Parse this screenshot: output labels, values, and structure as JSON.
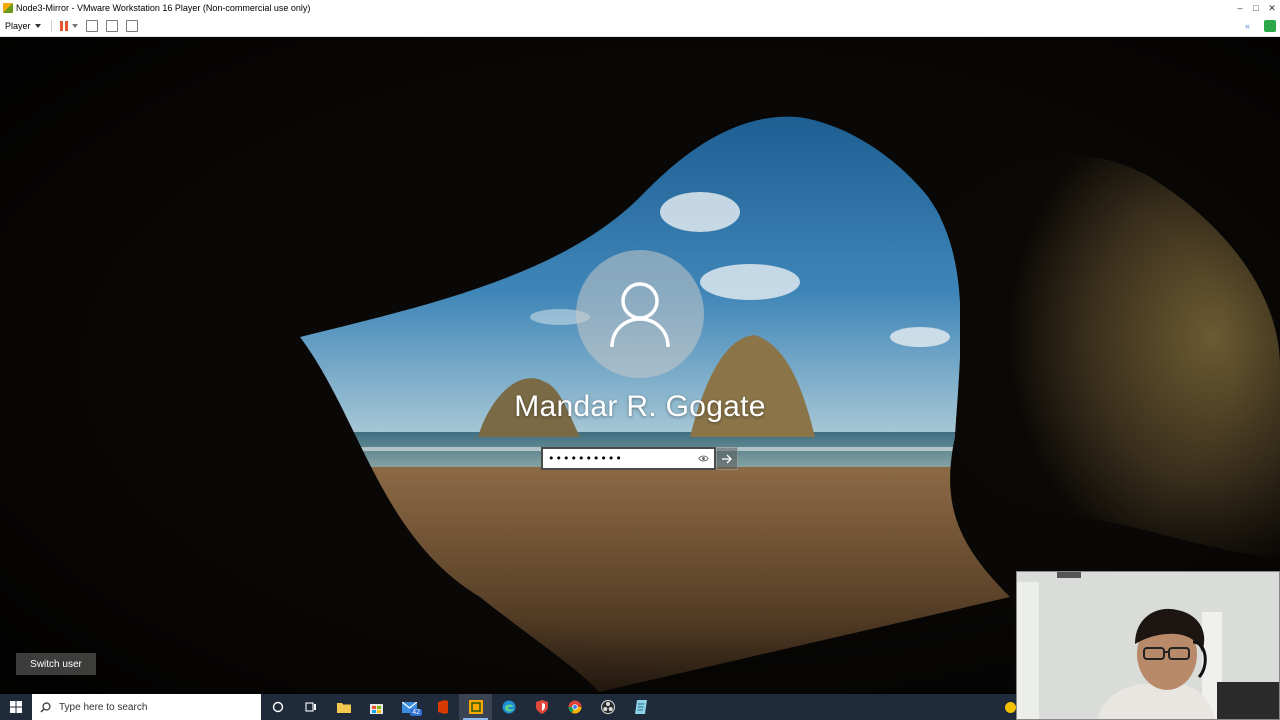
{
  "window": {
    "title": "Node3-Mirror - VMware Workstation 16 Player (Non-commercial use only)"
  },
  "toolbar": {
    "player_label": "Player"
  },
  "lock_screen": {
    "user_name": "Mandar R. Gogate",
    "password_value": "••••••••••",
    "switch_user_label": "Switch user"
  },
  "taskbar": {
    "search_placeholder": "Type here to search",
    "mail_badge": "42",
    "apps": [
      "task-view-icon",
      "file-explorer-icon",
      "store-icon",
      "mail-icon",
      "office-icon",
      "vmware-icon",
      "edge-icon",
      "shield-icon",
      "chrome-icon",
      "obs-icon",
      "notes-icon"
    ]
  },
  "colors": {
    "taskbar_bg": "#1f2a3a",
    "pause_accent": "#e0562a",
    "vmware_green": "#2aa84a"
  }
}
